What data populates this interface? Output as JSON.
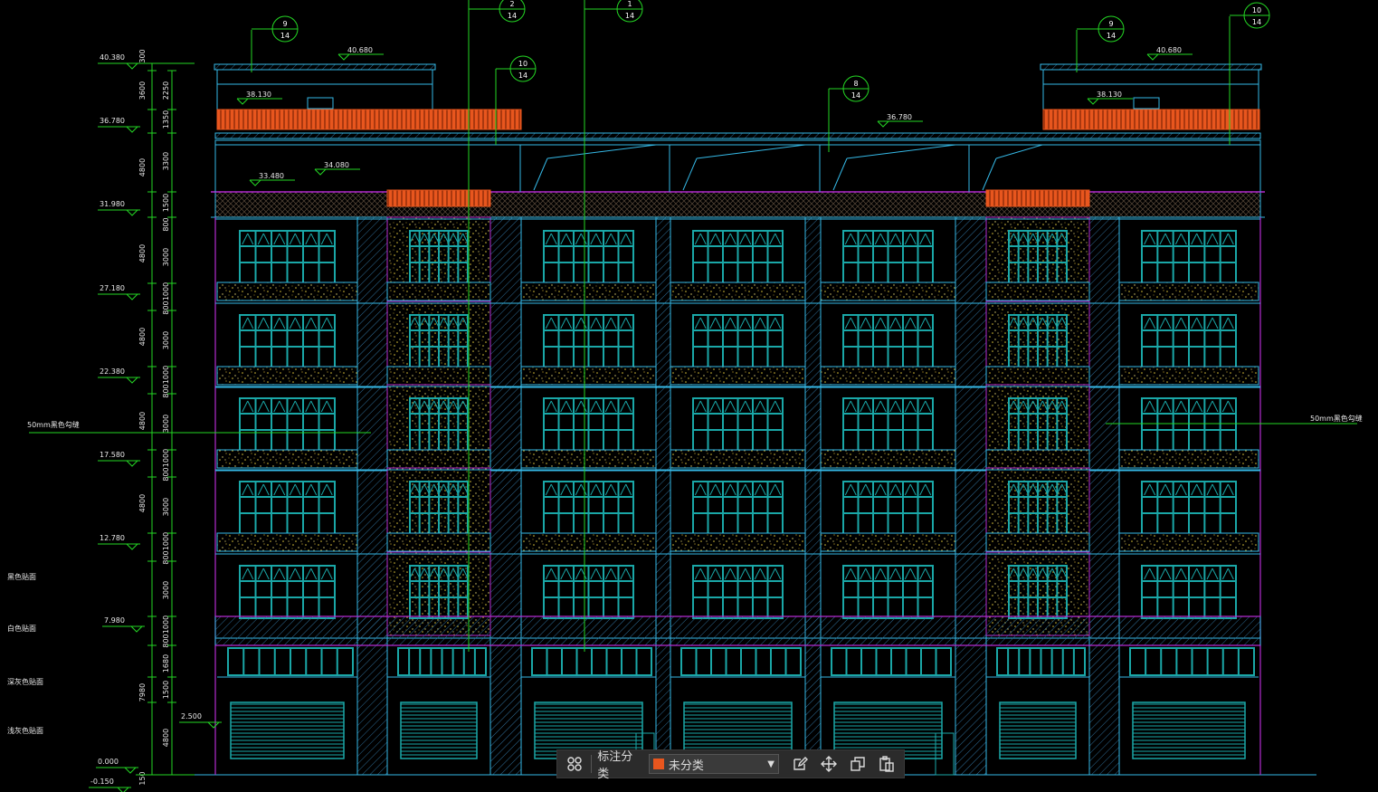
{
  "colors": {
    "background": "#000000",
    "outline": "#35b8e6",
    "window": "#1aa7a7",
    "hatch": "#2f6e98",
    "orange": "#e8561e",
    "speckle": "#d9c13a",
    "magenta": "#b42bd0",
    "green": "#24d624",
    "dim": "#e8e8e8",
    "toolbar_swatch": "#e8561e"
  },
  "elevation_labels": [
    "40.380",
    "36.780",
    "31.980",
    "27.180",
    "22.380",
    "17.580",
    "12.780",
    "7.980",
    "0.000",
    "-0.150",
    "2.500"
  ],
  "level_labels_top": [
    "40.680",
    "38.130",
    "36.780",
    "34.080",
    "33.480"
  ],
  "level_labels_right": [
    "40.680",
    "38.130"
  ],
  "dim_chain_outer": [
    "300",
    "3600",
    "4800",
    "4800",
    "4800",
    "4800",
    "4800",
    "7980",
    "150"
  ],
  "dim_chain_inner": [
    "2250",
    "1350",
    "3300",
    "1500",
    "800",
    "3000",
    "1000",
    "800",
    "3000",
    "1000",
    "800",
    "3000",
    "1000",
    "800",
    "3000",
    "1000",
    "800",
    "3000",
    "1000",
    "800",
    "1680",
    "1500",
    "4800"
  ],
  "material_notes": [
    "黑色贴面",
    "白色贴面",
    "深灰色贴面",
    "浅灰色贴面"
  ],
  "side_notes": {
    "left": "50mm黑色勾缝",
    "right": "50mm黑色勾缝"
  },
  "callouts": [
    {
      "num": "9",
      "den": "14"
    },
    {
      "num": "2",
      "den": "14"
    },
    {
      "num": "1",
      "den": "14"
    },
    {
      "num": "10",
      "den": "14"
    },
    {
      "num": "8",
      "den": "14"
    },
    {
      "num": "9",
      "den": "14"
    },
    {
      "num": "10",
      "den": "14"
    }
  ],
  "toolbar": {
    "label": "标注分类",
    "selected": "未分类",
    "grid_icon": "grid-icon",
    "edit_icon": "edit-icon",
    "move_icon": "move-icon",
    "copy_icon": "copy-icon",
    "paste_icon": "paste-icon"
  }
}
